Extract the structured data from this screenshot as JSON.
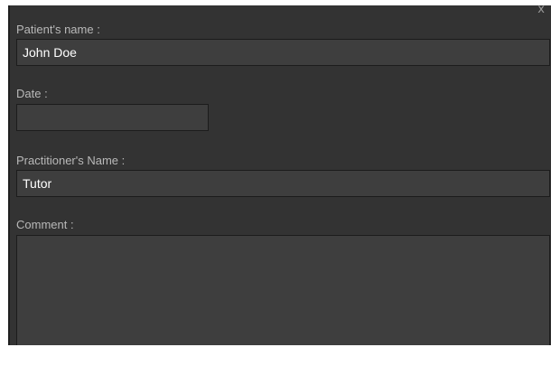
{
  "dialog": {
    "close_label": "x",
    "patient_name": {
      "label": "Patient's name :",
      "value": "John Doe"
    },
    "date": {
      "label": "Date :",
      "value": ""
    },
    "practitioner_name": {
      "label": "Practitioner's Name :",
      "value": "Tutor"
    },
    "comment": {
      "label": "Comment :",
      "value": ""
    }
  },
  "colors": {
    "panel_background": "#333333",
    "input_background": "#3e3e3e",
    "label_text": "#b9b9b9",
    "input_text": "#ffffff"
  }
}
